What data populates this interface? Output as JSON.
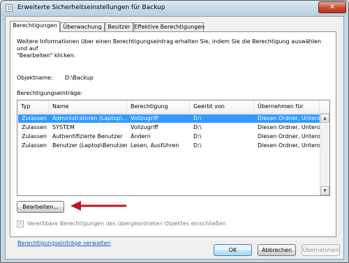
{
  "window": {
    "title": "Erweiterte Sicherheitseinstellungen für Backup",
    "close_icon": "close-icon",
    "app_icon": "document-icon"
  },
  "tabs": [
    {
      "label": "Berechtigungen",
      "active": true
    },
    {
      "label": "Überwachung",
      "active": false
    },
    {
      "label": "Besitzer",
      "active": false
    },
    {
      "label": "Effektive Berechtigungen",
      "active": false
    }
  ],
  "panel": {
    "info_line1": "Weitere Informationen über einen Berechtigungseintrag erhalten Sie, indem Sie die Berechtigung auswählen und auf",
    "info_line2": "\"Bearbeiten\" klicken.",
    "object_label": "Objektname:",
    "object_value": "D:\\Backup",
    "entries_label": "Berechtigungseinträge:",
    "columns": [
      "Typ",
      "Name",
      "Berechtigung",
      "Geerbt von",
      "Übernehmen für"
    ],
    "rows": [
      {
        "typ": "Zulassen",
        "name": "Administratoren (Laptop\\...",
        "berechtigung": "Vollzugriff",
        "geerbt": "D:\\",
        "uebernehmen": "Diesen Ordner, Unterordn...",
        "selected": true
      },
      {
        "typ": "Zulassen",
        "name": "SYSTEM",
        "berechtigung": "Vollzugriff",
        "geerbt": "D:\\",
        "uebernehmen": "Diesen Ordner, Unterordn...",
        "selected": false
      },
      {
        "typ": "Zulassen",
        "name": "Authentifizierte Benutzer",
        "berechtigung": "Ändern",
        "geerbt": "D:\\",
        "uebernehmen": "Diesen Ordner, Unterordn...",
        "selected": false
      },
      {
        "typ": "Zulassen",
        "name": "Benutzer (Laptop\\Benutzer)",
        "berechtigung": "Lesen, Ausführen",
        "geerbt": "D:\\",
        "uebernehmen": "Diesen Ordner, Unterordn...",
        "selected": false
      }
    ],
    "edit_button": "Bearbeiten...",
    "inherit_checkbox_label": "Vererbbare Berechtigungen des übergeordneten Objektes einschließen",
    "inherit_checked": true,
    "manage_link": "Berechtigungseinträge verwalten"
  },
  "footer": {
    "ok": "OK",
    "cancel": "Abbrechen",
    "apply": "Übernehmen"
  },
  "colors": {
    "selection": "#3399ff",
    "annotation_arrow": "#c0141b",
    "link": "#1a5bbd"
  }
}
